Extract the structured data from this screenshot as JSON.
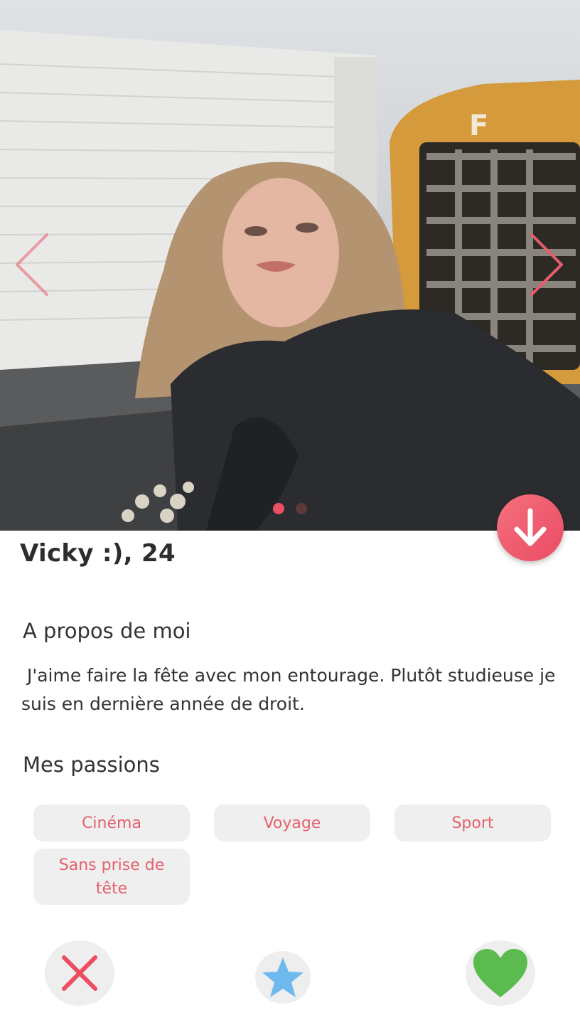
{
  "profile": {
    "name_age": "Vicky :), 24",
    "photo_description": "woman-with-blonde-hair-photo",
    "photo_count": 2,
    "current_photo_index": 1
  },
  "about": {
    "title": "A propos de moi",
    "text": " J'aime faire la fête avec mon entourage. Plutôt studieuse je suis en dernière année de droit."
  },
  "passions": {
    "title": "Mes passions",
    "items": [
      "Cinéma",
      "Voyage",
      "Sport",
      "Sans prise de tête"
    ]
  },
  "icons": {
    "prev": "chevron-left-icon",
    "next": "chevron-right-icon",
    "scroll_down": "arrow-down-icon",
    "dislike": "close-icon",
    "super_like": "star-icon",
    "like": "heart-icon"
  },
  "colors": {
    "accent": "#e5616c",
    "fab": "#ee5467",
    "dislike": "#ee4d5f",
    "star": "#6eb9ee",
    "heart": "#5bbb4f",
    "chip_bg": "#efefef",
    "dot_active": "#ec4f63",
    "dot_inactive": "#5b3a3a"
  }
}
